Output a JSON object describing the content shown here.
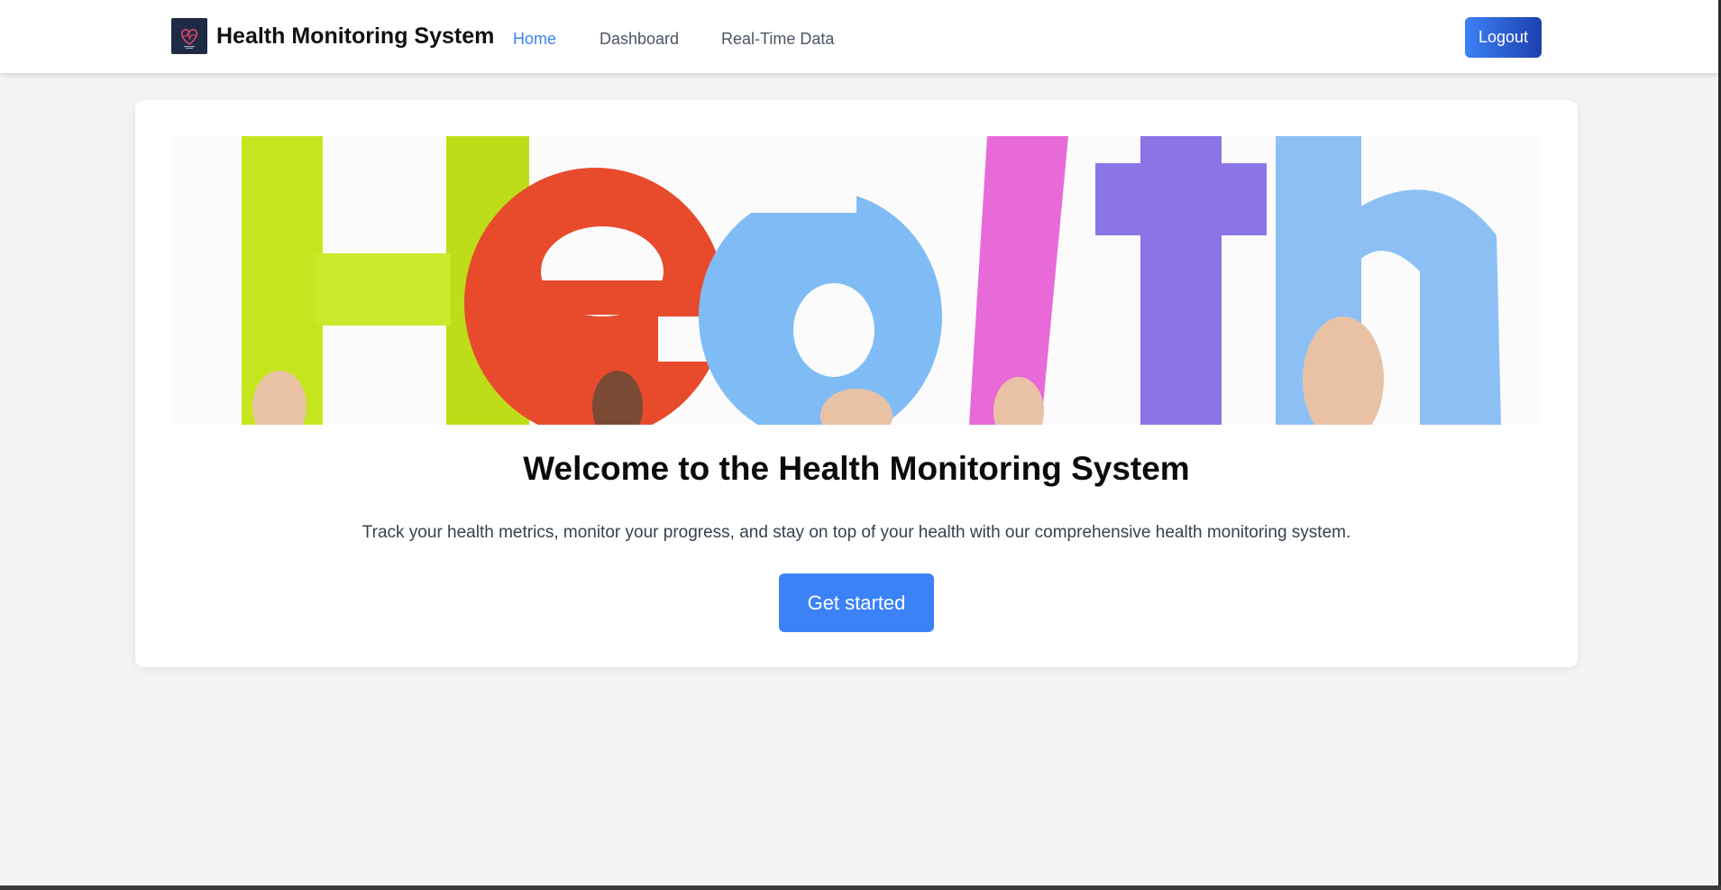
{
  "header": {
    "brand": "Health Monitoring System",
    "nav": [
      {
        "label": "Home",
        "active": true
      },
      {
        "label": "Dashboard",
        "active": false
      },
      {
        "label": "Real-Time Data",
        "active": false
      }
    ],
    "logout_label": "Logout"
  },
  "hero": {
    "image_word": "Health",
    "letter_colors": [
      "#c5e61f",
      "#e84a2c",
      "#7fbcf5",
      "#e86ad8",
      "#8b74e6",
      "#8cc0f5"
    ]
  },
  "main": {
    "title": "Welcome to the Health Monitoring System",
    "description": "Track your health metrics, monitor your progress, and stay on top of your health with our comprehensive health monitoring system.",
    "cta_label": "Get started"
  },
  "colors": {
    "accent": "#3b82f6",
    "background": "#f3f4f6"
  }
}
